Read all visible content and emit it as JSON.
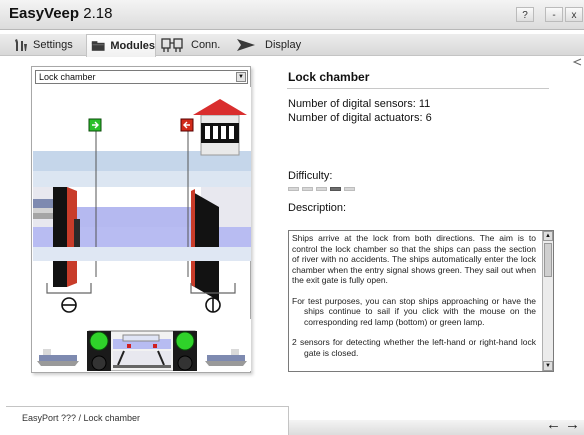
{
  "app": {
    "name": "EasyVeep",
    "version": "2.18"
  },
  "window_controls": {
    "help": "?",
    "minimize": "-",
    "close": "x"
  },
  "tabs": [
    {
      "label": "Settings",
      "icon": "settings-icon"
    },
    {
      "label": "Modules",
      "icon": "folder-icon",
      "active": true
    },
    {
      "label": "Conn.",
      "icon": "connector-icon"
    },
    {
      "label": "Display",
      "icon": "play-arrow-icon"
    }
  ],
  "simulation": {
    "selector_value": "Lock chamber",
    "left_lamp_color": "#31c52c",
    "right_lamp_color": "#31c52c",
    "signal_left": "green-arrow-right",
    "signal_right": "red-arrow-left"
  },
  "info": {
    "title": "Lock chamber",
    "sensors": "Number of digital sensors: 11",
    "actuators": "Number of digital actuators: 6",
    "difficulty_label": "Difficulty:",
    "difficulty_level": 4,
    "difficulty_max": 5,
    "description_label": "Description:"
  },
  "description": {
    "p1": "Ships arrive at the lock from both directions. The aim is to control the lock chamber so that the ships can pass the section of river with no accidents. The ships automatically enter the lock chamber when the entry signal shows green. They sail out when the exit gate is fully open.",
    "p2": "For test purposes, you can stop ships approaching or have the ships continue to sail if you click with the mouse on the corresponding red lamp (bottom) or green lamp.",
    "p3": "2 sensors for detecting whether the left-hand or right-hand lock gate is closed."
  },
  "status": {
    "path": "EasyPort ???  / Lock chamber"
  },
  "nav": {
    "back": "←",
    "forward": "→"
  }
}
